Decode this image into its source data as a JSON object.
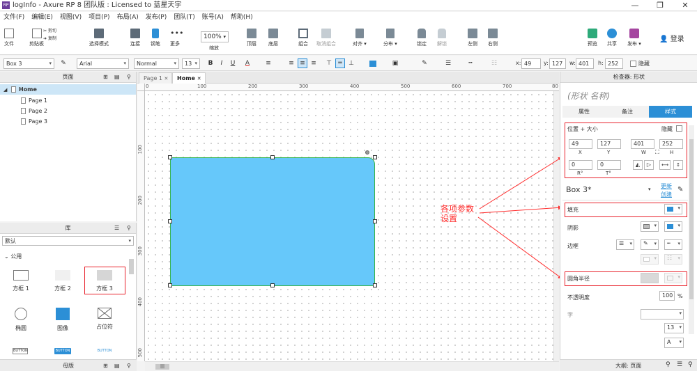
{
  "window": {
    "logo_text": "RP",
    "title": "logInfo - Axure RP 8 团队版 : Licensed to 蓝星天宇",
    "min_glyph": "—",
    "max_glyph": "❐",
    "close_glyph": "✕"
  },
  "menu": [
    "文件(F)",
    "编辑(E)",
    "视图(V)",
    "项目(P)",
    "布局(A)",
    "发布(P)",
    "团队(T)",
    "账号(A)",
    "帮助(H)"
  ],
  "ribbon": {
    "file": "文件",
    "clipboard": "剪贴板",
    "cut_label": "剪切",
    "copy_label": "复制",
    "paste_label": "粘贴",
    "select_mode": "选择模式",
    "connect": "连接",
    "pen": "钢笔",
    "more": "更多",
    "zoom_value": "100%",
    "zoom": "缩放",
    "top": "顶层",
    "bottom": "底层",
    "group": "组合",
    "ungroup": "取消组合",
    "align": "对齐",
    "distribute": "分布",
    "lock": "锁定",
    "unlock": "解锁",
    "left": "左侧",
    "right": "右侧",
    "preview": "预览",
    "share": "共享",
    "publish": "发布",
    "login": "登录"
  },
  "format": {
    "widget_name": "Box 3",
    "font_family": "Arial",
    "font_style": "Normal",
    "font_size": "13",
    "x_label": "x:",
    "x_value": "49",
    "y_label": "y:",
    "y_value": "127",
    "w_label": "w:",
    "w_value": "401",
    "h_label": "h:",
    "h_value": "252",
    "hidden_label": "隐藏",
    "bold": "B",
    "italic": "I",
    "underline": "U",
    "font_color": "A"
  },
  "pages": {
    "header": "页面",
    "items": [
      "Home",
      "Page 1",
      "Page 2",
      "Page 3"
    ]
  },
  "library": {
    "header": "库",
    "dropdown": "默认",
    "section": "公用",
    "widgets": [
      "方框 1",
      "方框 2",
      "方框 3",
      "椭圆",
      "图像",
      "占位符"
    ],
    "button_text": "BUTTON"
  },
  "masters": {
    "header": "母版"
  },
  "canvas": {
    "tabs": [
      {
        "label": "Page 1"
      },
      {
        "label": "Home"
      }
    ],
    "ruler_top": [
      "0",
      "100",
      "200",
      "300",
      "400",
      "500",
      "600",
      "700",
      "80"
    ],
    "ruler_left": [
      "100",
      "200",
      "300",
      "400",
      "500"
    ],
    "annotation": "各项参数\n设置",
    "annotation_color": "#ff2b2b",
    "box_fill": "#66c8fa",
    "box_border": "#37b34a"
  },
  "inspector": {
    "header": "检查器: 形状",
    "shape_name_placeholder": "(形状 名称)",
    "tabs": [
      "属性",
      "备注",
      "样式"
    ],
    "position_size": "位置 + 大小",
    "hidden": "隐藏",
    "x": "49",
    "y": "127",
    "w": "401",
    "h": "252",
    "x_lbl": "X",
    "y_lbl": "Y",
    "w_lbl": "W",
    "h_lbl": "H",
    "r_value": "0",
    "t_value": "0",
    "r_lbl": "R°",
    "t_lbl": "T°",
    "style_name": "Box 3*",
    "update": "更新",
    "create": "创建",
    "fill": "填充",
    "shadow": "阴影",
    "border": "边框",
    "corner_radius": "圆角半径",
    "opacity": "不透明度",
    "opacity_value": "100",
    "opacity_unit": "%",
    "font": "字",
    "font_size": "13",
    "fill_color": "#2c8fd6",
    "footer": "大纲: 页面"
  }
}
